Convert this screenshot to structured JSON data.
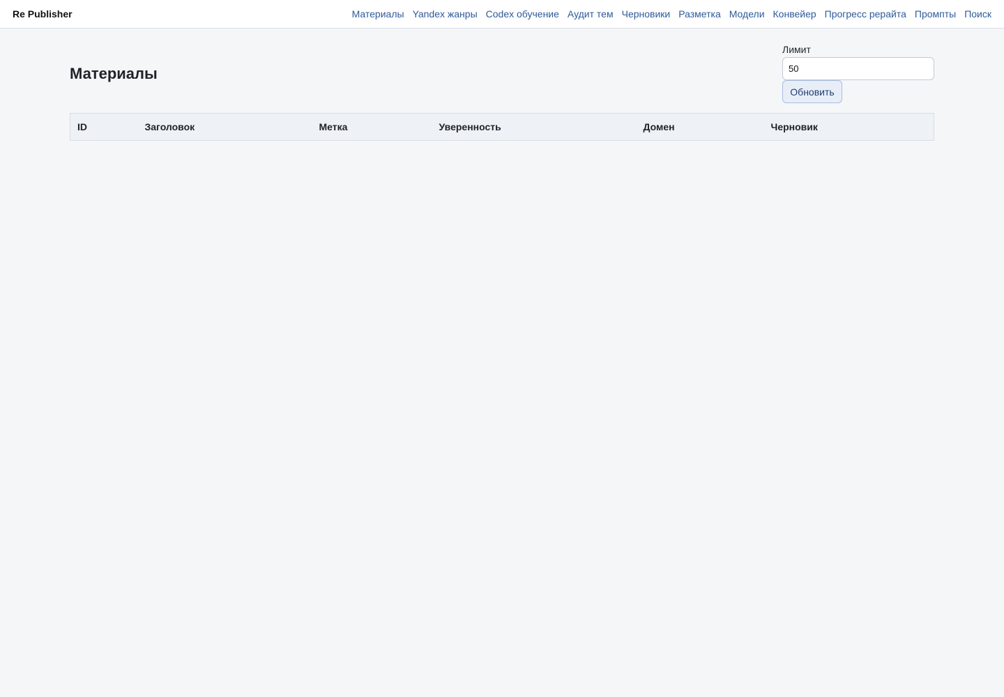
{
  "app": {
    "brand": "Re Publisher"
  },
  "nav": {
    "items": [
      {
        "label": "Материалы"
      },
      {
        "label": "Yandex жанры"
      },
      {
        "label": "Codex обучение"
      },
      {
        "label": "Аудит тем"
      },
      {
        "label": "Черновики"
      },
      {
        "label": "Разметка"
      },
      {
        "label": "Модели"
      },
      {
        "label": "Конвейер"
      },
      {
        "label": "Прогресс рерайта"
      },
      {
        "label": "Промпты"
      },
      {
        "label": "Поиск"
      }
    ]
  },
  "page": {
    "title": "Материалы"
  },
  "controls": {
    "limit_label": "Лимит",
    "limit_value": "50",
    "refresh_label": "Обновить"
  },
  "table": {
    "columns": [
      "ID",
      "Заголовок",
      "Метка",
      "Уверенность",
      "Домен",
      "Черновик"
    ],
    "rows": []
  },
  "colors": {
    "background": "#f4f6f8",
    "nav_link": "#2e5a9a",
    "header_bg": "#eef1f5",
    "button_bg": "#e8eef8"
  }
}
